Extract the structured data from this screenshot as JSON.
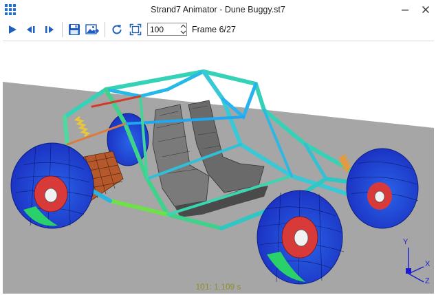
{
  "window": {
    "title": "Strand7 Animator - Dune Buggy.st7"
  },
  "icons": {
    "app": "grid-app-icon",
    "minimize": "minimize-icon",
    "close": "close-icon",
    "play": "play-icon",
    "step_back": "step-back-icon",
    "step_forward": "step-forward-icon",
    "save": "save-disk-icon",
    "export_image": "export-image-icon",
    "refresh": "refresh-icon",
    "fit": "fit-to-window-icon",
    "spin_up": "chevron-up-icon",
    "spin_down": "chevron-down-icon"
  },
  "toolbar": {
    "zoom_value": "100",
    "frame_label": "Frame 6/27"
  },
  "viewport": {
    "time_label": "101: 1.109 s",
    "axis_y": "Y",
    "axis_x": "X",
    "axis_z": "Z"
  },
  "colors": {
    "accent_blue": "#1f5fbf",
    "ground": "#a6a6a6",
    "time_label": "#8d8d2a",
    "axis": "#1a1ad0"
  }
}
